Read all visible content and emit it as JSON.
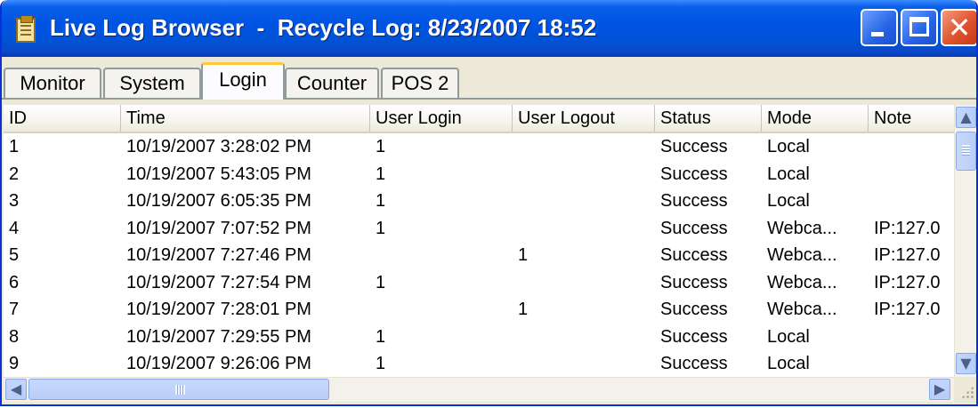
{
  "window": {
    "title": "Live Log Browser  -  Recycle Log: 8/23/2007 18:52",
    "icon": "clipboard-icon",
    "controls": [
      "minimize",
      "maximize",
      "close"
    ],
    "close_glyph": "✕"
  },
  "tabs": [
    {
      "label": "Monitor",
      "active": false
    },
    {
      "label": "System",
      "active": false
    },
    {
      "label": "Login",
      "active": true
    },
    {
      "label": "Counter",
      "active": false
    },
    {
      "label": "POS 2",
      "active": false
    }
  ],
  "table": {
    "columns": [
      "ID",
      "Time",
      "User Login",
      "User Logout",
      "Status",
      "Mode",
      "Note"
    ],
    "rows": [
      [
        "1",
        "10/19/2007 3:28:02 PM",
        "1",
        "",
        "Success",
        "Local",
        ""
      ],
      [
        "2",
        "10/19/2007 5:43:05 PM",
        "1",
        "",
        "Success",
        "Local",
        ""
      ],
      [
        "3",
        "10/19/2007 6:05:35 PM",
        "1",
        "",
        "Success",
        "Local",
        ""
      ],
      [
        "4",
        "10/19/2007 7:07:52 PM",
        "1",
        "",
        "Success",
        "Webca...",
        "IP:127.0"
      ],
      [
        "5",
        "10/19/2007 7:27:46 PM",
        "",
        "1",
        "Success",
        "Webca...",
        "IP:127.0"
      ],
      [
        "6",
        "10/19/2007 7:27:54 PM",
        "1",
        "",
        "Success",
        "Webca...",
        "IP:127.0"
      ],
      [
        "7",
        "10/19/2007 7:28:01 PM",
        "",
        "1",
        "Success",
        "Webca...",
        "IP:127.0"
      ],
      [
        "8",
        "10/19/2007 7:29:55 PM",
        "1",
        "",
        "Success",
        "Local",
        ""
      ],
      [
        "9",
        "10/19/2007 9:26:06 PM",
        "1",
        "",
        "Success",
        "Local",
        ""
      ]
    ]
  },
  "scrollbars": {
    "up_arrow": "▲",
    "down_arrow": "▼",
    "left_arrow": "◀",
    "right_arrow": "▶"
  },
  "colors": {
    "titlebar": "#0054e3",
    "active_tab_highlight": "#ffc83c",
    "close_button": "#e0532e"
  }
}
